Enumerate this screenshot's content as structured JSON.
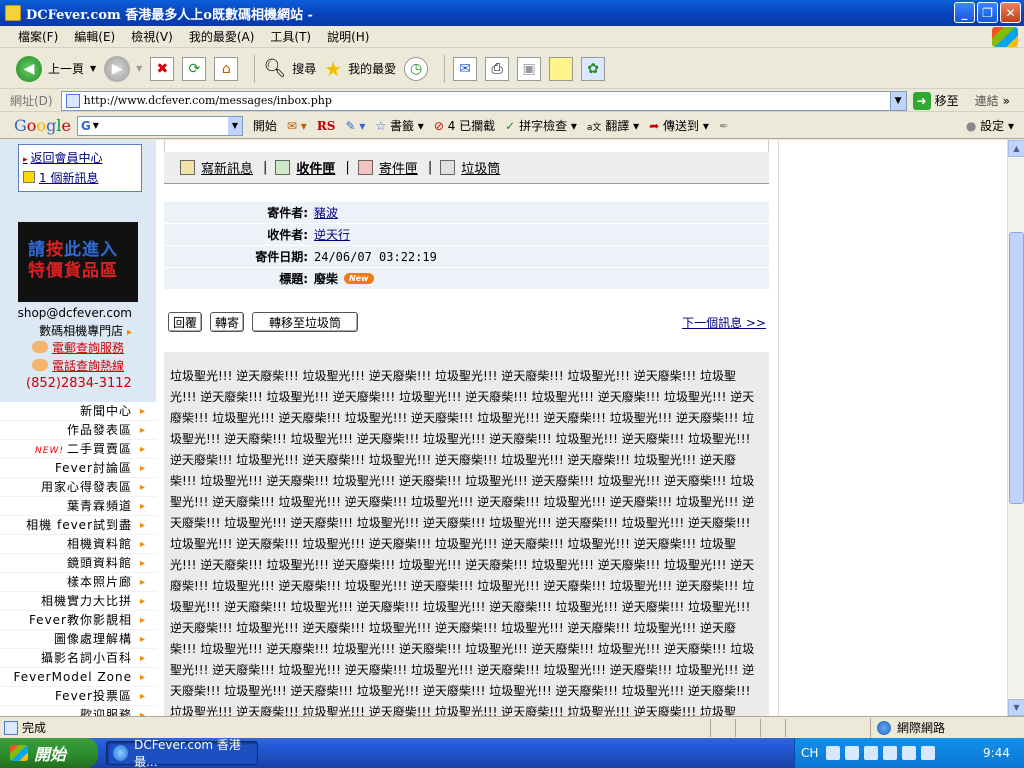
{
  "window": {
    "title": "DCFever.com 香港最多人上o既數碼相機網站 -"
  },
  "menu": [
    "檔案(F)",
    "編輯(E)",
    "檢視(V)",
    "我的最愛(A)",
    "工具(T)",
    "說明(H)"
  ],
  "toolbar": {
    "back_label": "上一頁",
    "search_label": "搜尋",
    "favorites_label": "我的最愛"
  },
  "address": {
    "label": "網址(D)",
    "url": "http://www.dcfever.com/messages/inbox.php",
    "go_label": "移至",
    "links_label": "連結"
  },
  "google_bar": {
    "logo": [
      "G",
      "o",
      "o",
      "g",
      "l",
      "e"
    ],
    "search_badge": "G",
    "start_label": "開始",
    "rs_label": "RS",
    "bookmarks_label": "書籤",
    "blocked_label": "4 已攔截",
    "spellcheck_label": "拼字檢查",
    "translate_label": "翻譯",
    "sendto_label": "傳送到",
    "settings_label": "設定"
  },
  "sidebar": {
    "back_to_member": "返回會員中心",
    "new_messages": "1 個新訊息",
    "promo_line1_a": "請",
    "promo_line1_b": "按",
    "promo_line1_c": "此進入",
    "promo_line2": "特價貨品區",
    "shop_email": "shop@dcfever.com",
    "shop_dept": "數碼相機專門店",
    "email_service": "電郵查詢服務",
    "phone_service": "電話查詢熱線",
    "phone": "(852)2834-3112",
    "nav": [
      {
        "label": "新聞中心",
        "new": ""
      },
      {
        "label": "作品發表區",
        "new": ""
      },
      {
        "label": "二手買賣區",
        "new": "NEW!"
      },
      {
        "label": "Fever討論區",
        "new": ""
      },
      {
        "label": "用家心得發表區",
        "new": ""
      },
      {
        "label": "葉青霖頻道",
        "new": ""
      },
      {
        "label": "相機 fever試到盡",
        "new": ""
      },
      {
        "label": "相機資料館",
        "new": ""
      },
      {
        "label": "鏡頭資料館",
        "new": ""
      },
      {
        "label": "樣本照片廊",
        "new": ""
      },
      {
        "label": "相機實力大比拼",
        "new": ""
      },
      {
        "label": "Fever教你影靚相",
        "new": ""
      },
      {
        "label": "圖像處理解構",
        "new": ""
      },
      {
        "label": "攝影名詞小百科",
        "new": ""
      },
      {
        "label": "FeverModel Zone",
        "new": ""
      },
      {
        "label": "Fever投票區",
        "new": ""
      },
      {
        "label": "歡迎服務",
        "new": ""
      }
    ]
  },
  "tabs": {
    "compose": "寫新訊息",
    "inbox": "收件匣",
    "sent": "寄件匣",
    "trash": "垃圾筒"
  },
  "message": {
    "sender_label": "寄件者:",
    "sender": "豬波",
    "recipient_label": "收件者:",
    "recipient": "逆天行",
    "date_label": "寄件日期:",
    "date": "24/06/07 03:22:19",
    "subject_label": "標題:",
    "subject": "廢柴",
    "new_badge": "New",
    "reply_label": "回覆",
    "forward_label": "轉寄",
    "move_trash_label": "轉移至垃圾筒",
    "next_label": "下一個訊息 >>",
    "body": "垃圾聖光!!! 逆天廢柴!!! 垃圾聖光!!! 逆天廢柴!!! 垃圾聖光!!! 逆天廢柴!!! 垃圾聖光!!! 逆天廢柴!!! 垃圾聖光!!! 逆天廢柴!!! 垃圾聖光!!! 逆天廢柴!!! 垃圾聖光!!! 逆天廢柴!!! 垃圾聖光!!! 逆天廢柴!!! 垃圾聖光!!! 逆天廢柴!!! 垃圾聖光!!! 逆天廢柴!!! 垃圾聖光!!! 逆天廢柴!!! 垃圾聖光!!! 逆天廢柴!!! 垃圾聖光!!! 逆天廢柴!!! 垃圾聖光!!! 逆天廢柴!!! 垃圾聖光!!! 逆天廢柴!!! 垃圾聖光!!! 逆天廢柴!!! 垃圾聖光!!! 逆天廢柴!!! 垃圾聖光!!! 逆天廢柴!!! 垃圾聖光!!! 逆天廢柴!!! 垃圾聖光!!! 逆天廢柴!!! 垃圾聖光!!! 逆天廢柴!!! 垃圾聖光!!! 逆天廢柴!!! 垃圾聖光!!! 逆天廢柴!!! 垃圾聖光!!! 逆天廢柴!!! 垃圾聖光!!! 逆天廢柴!!! 垃圾聖光!!! 逆天廢柴!!! 垃圾聖光!!! 逆天廢柴!!! 垃圾聖光!!! 逆天廢柴!!! 垃圾聖光!!! 逆天廢柴!!! 垃圾聖光!!! 逆天廢柴!!! 垃圾聖光!!! 逆天廢柴!!! 垃圾聖光!!! 逆天廢柴!!! 垃圾聖光!!! 逆天廢柴!!! 垃圾聖光!!! 逆天廢柴!!! 垃圾聖光!!! 逆天廢柴!!! 垃圾聖光!!! 逆天廢柴!!! 垃圾聖光!!! 逆天廢柴!!! 垃圾聖光!!! 逆天廢柴!!! 垃圾聖光!!! 逆天廢柴!!! 垃圾聖光!!! 逆天廢柴!!! 垃圾聖光!!! 逆天廢柴!!! 垃圾聖光!!! 逆天廢柴!!! 垃圾聖光!!! 逆天廢柴!!! 垃圾聖光!!! 逆天廢柴!!! 垃圾聖光!!! 逆天廢柴!!! 垃圾聖光!!! 逆天廢柴!!! 垃圾聖光!!! 逆天廢柴!!! 垃圾聖光!!! 逆天廢柴!!! 垃圾聖光!!! 逆天廢柴!!! 垃圾聖光!!! 逆天廢柴!!! 垃圾聖光!!! 逆天廢柴!!! 垃圾聖光!!! 逆天廢柴!!! 垃圾聖光!!! 逆天廢柴!!! 垃圾聖光!!! 逆天廢柴!!! 垃圾聖光!!! 逆天廢柴!!! 垃圾聖光!!! 逆天廢柴!!! 垃圾聖光!!! 逆天廢柴!!! 垃圾聖光!!! 逆天廢柴!!! 垃圾聖光!!! 逆天廢柴!!! 垃圾聖光!!! 逆天廢柴!!! 垃圾聖光!!! 逆天廢柴!!! 垃圾聖光!!! 逆天廢柴!!! 垃圾聖光!!! 逆天廢柴!!! 垃圾聖光!!! 逆天廢柴!!! 垃圾聖光!!! 逆天廢柴!!! 垃圾聖光!!! 逆天廢柴!!! 垃圾聖光!!! 逆天廢柴!!! 垃圾聖光!!! 逆天廢柴!!! 垃圾聖光!!! 逆天廢柴!!! 垃圾聖光!!! 逆天廢柴!!! 垃圾聖光!!! 逆天廢柴!!! 垃圾聖光!!! 逆天廢柴!!! 垃圾聖光!!! 逆天廢柴!!! 垃圾聖光!!! 逆天廢柴!!! 垃圾聖光!!! 逆天廢柴!!! 垃圾聖光!!! 逆天廢柴!!! 垃圾聖光!!! 逆天廢柴!!! 垃圾聖光!!! 逆天廢柴!!! 垃圾聖光!!! 逆天廢柴!!! 垃圾聖光!!! 逆天廢柴!!! 垃圾聖光!!! 逆天廢柴!!! 垃圾聖光!!! 逆天廢柴!!! 垃圾聖光!!! 逆天廢柴!!! 垃圾聖光!!! 逆天廢柴!!! 垃圾聖光!!! 逆天廢柴!!! 垃圾聖光!!! 逆天廢柴!!! 垃圾聖光!!! 逆天廢柴!!!"
  },
  "status": {
    "done": "完成",
    "zone": "網際網路"
  },
  "taskbar": {
    "start_label": "開始",
    "task_label": "DCFever.com 香港最...",
    "lang": "CH",
    "clock": "9:44"
  }
}
